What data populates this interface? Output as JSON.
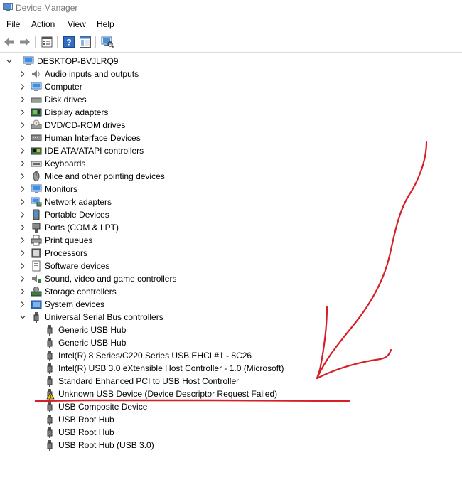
{
  "window": {
    "title": "Device Manager"
  },
  "menu": [
    "File",
    "Action",
    "View",
    "Help"
  ],
  "toolbar": {
    "buttons": [
      "back-icon",
      "forward-icon",
      "properties-icon",
      "help-icon",
      "show-hide-console-tree-icon",
      "scan-hardware-icon"
    ]
  },
  "tree": {
    "root": "DESKTOP-BVJLRQ9",
    "categories": [
      {
        "label": "Audio inputs and outputs",
        "icon": "speaker-icon"
      },
      {
        "label": "Computer",
        "icon": "computer-icon"
      },
      {
        "label": "Disk drives",
        "icon": "disk-drive-icon"
      },
      {
        "label": "Display adapters",
        "icon": "display-adapter-icon"
      },
      {
        "label": "DVD/CD-ROM drives",
        "icon": "dvd-drive-icon"
      },
      {
        "label": "Human Interface Devices",
        "icon": "hid-icon"
      },
      {
        "label": "IDE ATA/ATAPI controllers",
        "icon": "ide-controller-icon"
      },
      {
        "label": "Keyboards",
        "icon": "keyboard-icon"
      },
      {
        "label": "Mice and other pointing devices",
        "icon": "mouse-icon"
      },
      {
        "label": "Monitors",
        "icon": "monitor-icon"
      },
      {
        "label": "Network adapters",
        "icon": "network-adapter-icon"
      },
      {
        "label": "Portable Devices",
        "icon": "portable-device-icon"
      },
      {
        "label": "Ports (COM & LPT)",
        "icon": "port-icon"
      },
      {
        "label": "Print queues",
        "icon": "printer-icon"
      },
      {
        "label": "Processors",
        "icon": "processor-icon"
      },
      {
        "label": "Software devices",
        "icon": "software-device-icon"
      },
      {
        "label": "Sound, video and game controllers",
        "icon": "sound-controller-icon"
      },
      {
        "label": "Storage controllers",
        "icon": "storage-controller-icon"
      },
      {
        "label": "System devices",
        "icon": "system-device-icon"
      },
      {
        "label": "Universal Serial Bus controllers",
        "icon": "usb-controller-icon",
        "expanded": true
      }
    ],
    "usb_children": [
      {
        "label": "Generic USB Hub",
        "warning": false
      },
      {
        "label": "Generic USB Hub",
        "warning": false
      },
      {
        "label": "Intel(R) 8 Series/C220 Series USB EHCI #1 - 8C26",
        "warning": false
      },
      {
        "label": "Intel(R) USB 3.0 eXtensible Host Controller - 1.0 (Microsoft)",
        "warning": false
      },
      {
        "label": "Standard Enhanced PCI to USB Host Controller",
        "warning": false
      },
      {
        "label": "Unknown USB Device (Device Descriptor Request Failed)",
        "warning": true
      },
      {
        "label": "USB Composite Device",
        "warning": false
      },
      {
        "label": "USB Root Hub",
        "warning": false
      },
      {
        "label": "USB Root Hub",
        "warning": false
      },
      {
        "label": "USB Root Hub (USB 3.0)",
        "warning": false
      }
    ]
  },
  "colors": {
    "annotation": "#d61f26",
    "warning": "#f2c200"
  }
}
